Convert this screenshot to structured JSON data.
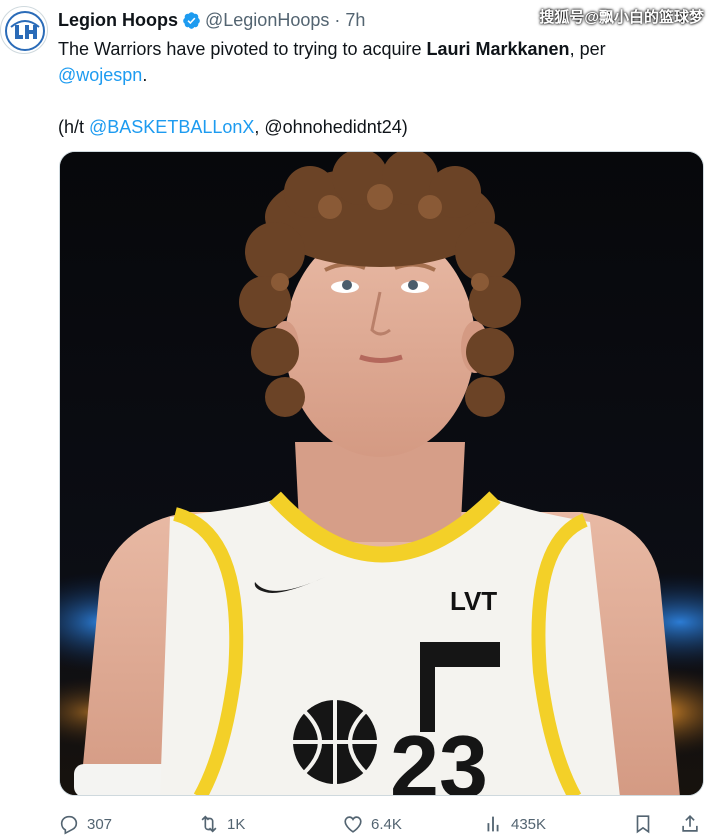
{
  "tweet": {
    "author": {
      "display_name": "Legion Hoops",
      "handle": "@LegionHoops",
      "separator": "·",
      "time": "7h",
      "verified": true
    },
    "text": {
      "line1_a": "The Warriors have pivoted to trying to acquire ",
      "line1_bold": "Lauri Markkanen",
      "line1_b": ", per",
      "line2_mention": "@wojespn",
      "line2_end": ".",
      "line3_a": "(h/t ",
      "line3_mention": "@BASKETBALLonX",
      "line3_b": ", @ohnohedidnt24)"
    },
    "watermark": "搜狐号@飘小白的篮球梦",
    "media": {
      "alt": "",
      "jersey_number": "23",
      "jersey_logo": "LVT"
    },
    "actions": {
      "replies": "307",
      "reposts": "1K",
      "likes": "6.4K",
      "views": "435K"
    }
  },
  "colors": {
    "link": "#1d9bf0",
    "muted": "#536471",
    "verified_badge": "#1d9bf0",
    "jersey_trim": "#f3d028"
  },
  "icons": [
    "verified-badge-icon",
    "reply-icon",
    "repost-icon",
    "like-icon",
    "views-icon",
    "bookmark-icon",
    "share-icon"
  ]
}
